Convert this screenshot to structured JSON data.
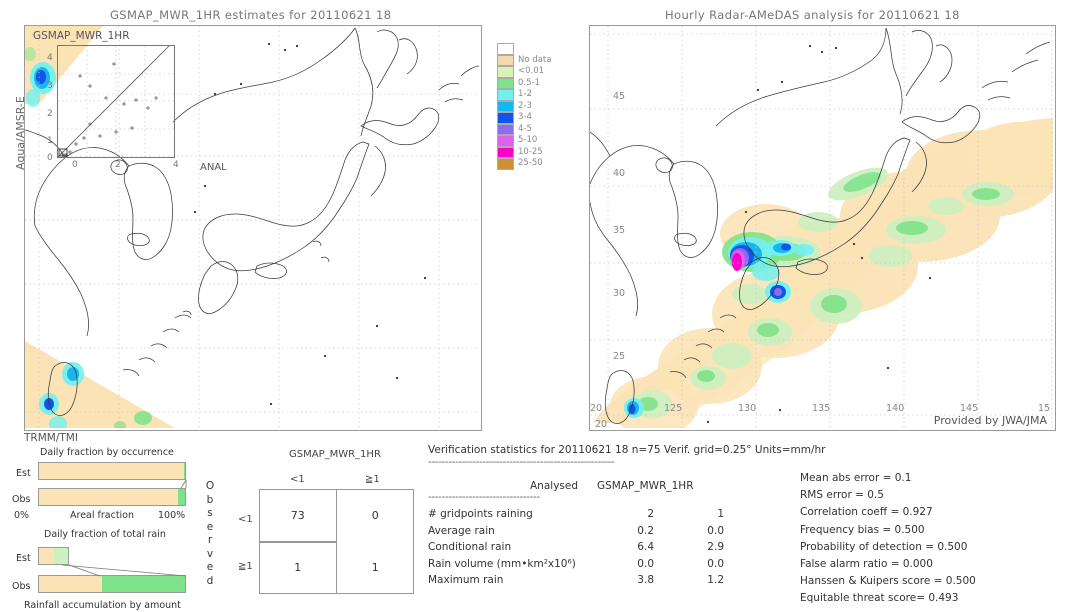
{
  "left_panel": {
    "title": "GSMAP_MWR_1HR estimates for 20110621 18",
    "y_axis_label": "Aqua/AMSR-E",
    "corner_label": "GSMAP_MWR_1HR",
    "bottom_label": "TRMM/TMI",
    "inset": {
      "x_axis_label": "ANAL",
      "y_ticks": [
        "4",
        "3",
        "2",
        "1",
        "0"
      ],
      "x_ticks": [
        "0",
        "2",
        "4"
      ]
    }
  },
  "right_panel": {
    "title": "Hourly Radar-AMeDAS analysis for 20110621 18",
    "credit": "Provided by JWA/JMA",
    "lat_ticks": [
      "45",
      "40",
      "35",
      "30",
      "25",
      "20"
    ],
    "lon_ticks": [
      "20",
      "125",
      "130",
      "135",
      "140",
      "145",
      "15"
    ]
  },
  "colorbar": {
    "labels": [
      "No data",
      "<0.01",
      "0.5-1",
      "1-2",
      "2-3",
      "3-4",
      "4-5",
      "5-10",
      "10-25",
      "25-50"
    ],
    "swatches": [
      "#ffffff",
      "#f6d9a8",
      "#d8f2b8",
      "#7ce38b",
      "#72f0ee",
      "#18b6ee",
      "#1155ee",
      "#8d6bf0",
      "#e060ef",
      "#ff00c8",
      "#cc9233"
    ],
    "swatch_count": 11
  },
  "contingency": {
    "model_label": "GSMAP_MWR_1HR",
    "col_headers": [
      "<1",
      "≧1"
    ],
    "row_headers": [
      "<1",
      "≧1"
    ],
    "observed_label": "Observed",
    "cells": [
      [
        "73",
        "0"
      ],
      [
        "1",
        "1"
      ]
    ]
  },
  "bars": {
    "chart1_title": "Daily fraction by occurrence",
    "chart1_rows": [
      {
        "label": "Est",
        "segments": [
          {
            "color": "#fbe3b6",
            "pct": 99.0
          },
          {
            "color": "#7ce38b",
            "pct": 1.0
          }
        ]
      },
      {
        "label": "Obs",
        "segments": [
          {
            "color": "#fbe3b6",
            "pct": 95.5
          },
          {
            "color": "#7ce38b",
            "pct": 4.5
          }
        ]
      }
    ],
    "axis_left": "0%",
    "axis_center": "Areal fraction",
    "axis_right": "100%",
    "chart2_title": "Daily fraction of total rain",
    "chart2_rows": [
      {
        "label": "Est",
        "segments": [
          {
            "color": "#fbe3b6",
            "pct": 11.0
          },
          {
            "color": "#cdf0bf",
            "pct": 10.0
          }
        ]
      },
      {
        "label": "Obs",
        "segments": [
          {
            "color": "#fbe3b6",
            "pct": 43.0
          },
          {
            "color": "#7ce38b",
            "pct": 57.0
          }
        ]
      }
    ],
    "chart2_caption": "Rainfall accumulation by amount"
  },
  "verification": {
    "header": "Verification statistics for 20110621 18  n=75  Verif. grid=0.25°  Units=mm/hr",
    "rule": "-------------------------------------------------------",
    "col1": "Analysed",
    "col2": "GSMAP_MWR_1HR",
    "rule2": "---------------------------------",
    "rows": [
      {
        "name": "# gridpoints raining",
        "analysed": "2",
        "model": "1"
      },
      {
        "name": "Average rain",
        "analysed": "0.2",
        "model": "0.0"
      },
      {
        "name": "Conditional rain",
        "analysed": "6.4",
        "model": "2.9"
      },
      {
        "name": "Rain volume (mm•km²x10⁶)",
        "analysed": "0.0",
        "model": "0.0"
      },
      {
        "name": "Maximum rain",
        "analysed": "3.8",
        "model": "1.2"
      }
    ],
    "scores": [
      "Mean abs error = 0.1",
      "RMS error = 0.5",
      "Correlation coeff = 0.927",
      "Frequency bias = 0.500",
      "Probability of detection = 0.500",
      "False alarm ratio = 0.000",
      "Hanssen & Kuipers score = 0.500",
      "Equitable threat score= 0.493"
    ]
  }
}
